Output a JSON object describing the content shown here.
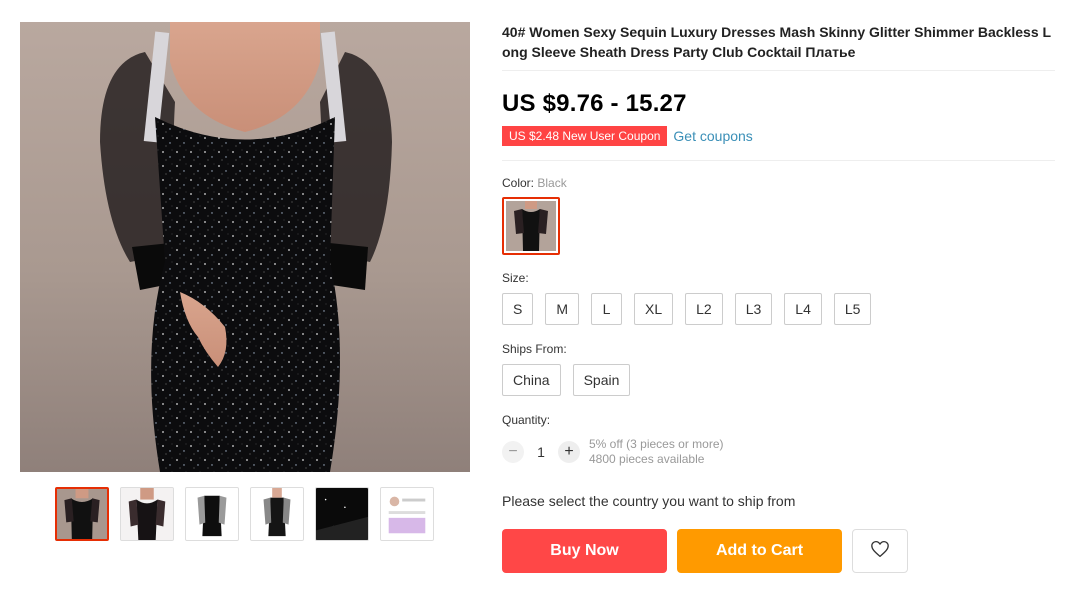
{
  "product": {
    "title": "40# Women Sexy Sequin Luxury Dresses Mash Skinny Glitter Shimmer Backless Long Sleeve Sheath Dress Party Club Cocktail Платье",
    "price": "US $9.76 - 15.27",
    "coupon": "US $2.48 New User Coupon",
    "get_coupons": "Get coupons"
  },
  "gallery": {
    "thumbnails": [
      "front-sequin",
      "front-sequin-alt",
      "back-view",
      "model-back",
      "fabric-close-up",
      "size-chart"
    ]
  },
  "color": {
    "label": "Color:",
    "selected": "Black"
  },
  "size": {
    "label": "Size:",
    "options": [
      "S",
      "M",
      "L",
      "XL",
      "L2",
      "L3",
      "L4",
      "L5"
    ]
  },
  "ships_from": {
    "label": "Ships From:",
    "options": [
      "China",
      "Spain"
    ]
  },
  "quantity": {
    "label": "Quantity:",
    "value": "1",
    "minus": "−",
    "plus": "+",
    "discount": "5% off (3 pieces or more)",
    "available": "4800 pieces available"
  },
  "shipping_message": "Please select the country you want to ship from",
  "actions": {
    "buy_now": "Buy Now",
    "add_to_cart": "Add to Cart",
    "wishlist_icon": "heart-icon"
  },
  "colors": {
    "accent_red": "#ff4747",
    "cart_orange": "#ff9a00",
    "link_blue": "#3a8fb7",
    "selected_border": "#e62e04"
  }
}
